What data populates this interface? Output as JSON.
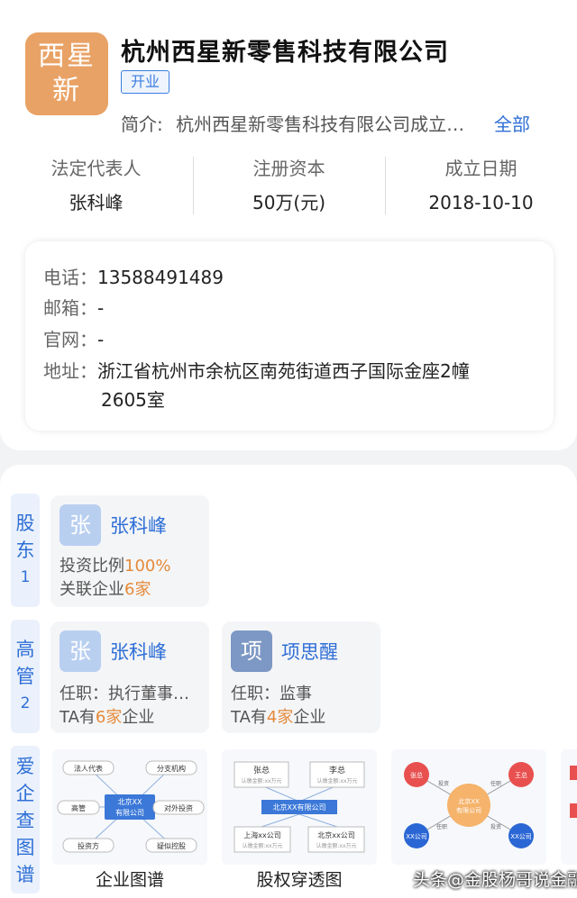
{
  "company": {
    "logo_line1": "西星",
    "logo_line2": "新",
    "name": "杭州西星新零售科技有限公司",
    "status": "开业",
    "intro_label": "简介:",
    "intro_text": "杭州西星新零售科技有限公司成立…",
    "intro_more": "全部"
  },
  "info": [
    {
      "label": "法定代表人",
      "value": "张科峰"
    },
    {
      "label": "注册资本",
      "value": "50万(元)"
    },
    {
      "label": "成立日期",
      "value": "2018-10-10"
    }
  ],
  "contact": {
    "phone_label": "电话：",
    "phone": "13588491489",
    "email_label": "邮箱：",
    "email": "-",
    "site_label": "官网：",
    "site": "-",
    "address_label": "地址：",
    "address_line1": "浙江省杭州市余杭区南苑街道西子国际金座2幢",
    "address_line2": "2605室"
  },
  "shareholders": {
    "tab_line1": "股",
    "tab_line2": "东",
    "count": "1",
    "items": [
      {
        "avatar": "张",
        "name": "张科峰",
        "ratio_label": "投资比例",
        "ratio": "100%",
        "related_label": "关联企业",
        "related": "6家"
      }
    ]
  },
  "executives": {
    "tab_line1": "高",
    "tab_line2": "管",
    "count": "2",
    "items": [
      {
        "avatar": "张",
        "name": "张科峰",
        "role": "任职：执行董事…",
        "prefix": "TA有",
        "count": "6家",
        "suffix": "企业"
      },
      {
        "avatar": "项",
        "name": "项思醒",
        "role": "任职：监事",
        "prefix": "TA有",
        "count": "4家",
        "suffix": "企业"
      }
    ]
  },
  "aiqicha": {
    "tab_chars": [
      "爱",
      "企",
      "查",
      "图",
      "谱"
    ],
    "graph": {
      "center": "北京XX有限公司",
      "nodes": [
        "法人代表",
        "分支机构",
        "高管",
        "对外投资",
        "投资方",
        "疑似控股"
      ]
    },
    "equity": {
      "top_left": "张总",
      "top_right": "李总",
      "center": "北京XX有限公司",
      "bottom_left": "上海xx公司",
      "bottom_right": "北京xx公司",
      "sub": "认缴金额:xx万元"
    },
    "relation": {
      "center": "北京XX有限公司",
      "nodes": [
        "张总",
        "王总",
        "XX公司",
        "XX公司"
      ],
      "edge_labels": [
        "投资",
        "任职",
        "任职",
        "投资"
      ]
    },
    "captions": [
      "企业图谱",
      "股权穿透图"
    ]
  },
  "watermark": "头条@金股杨哥说金融",
  "colors": {
    "accent": "#2f6fd6",
    "highlight": "#e58a3a",
    "logo": "#e9a265"
  }
}
